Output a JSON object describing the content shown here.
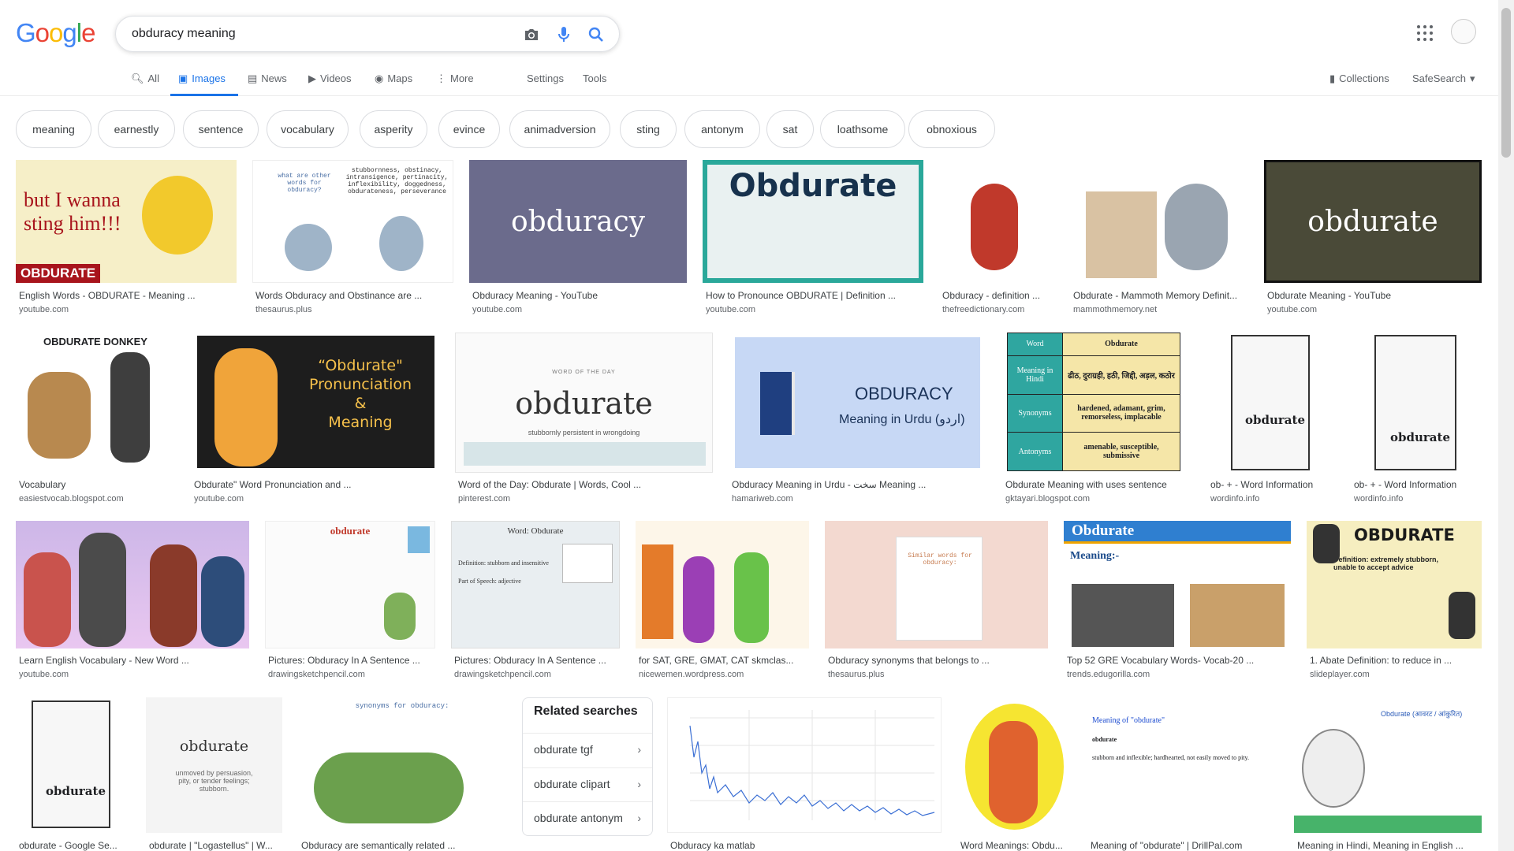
{
  "logo": {
    "letters": [
      "G",
      "o",
      "o",
      "g",
      "l",
      "e"
    ],
    "colors": [
      "#4285f4",
      "#ea4335",
      "#fbbc05",
      "#4285f4",
      "#34a853",
      "#ea4335"
    ]
  },
  "search": {
    "value": "obduracy meaning"
  },
  "tabs": {
    "all": "All",
    "images": "Images",
    "news": "News",
    "videos": "Videos",
    "maps": "Maps",
    "more": "More",
    "settings": "Settings",
    "tools": "Tools"
  },
  "right": {
    "collections": "Collections",
    "safesearch": "SafeSearch"
  },
  "chips": [
    "meaning",
    "earnestly",
    "sentence",
    "vocabulary",
    "asperity",
    "evince",
    "animadversion",
    "sting",
    "antonym",
    "sat",
    "loathsome",
    "obnoxious"
  ],
  "row1": [
    {
      "title": "English Words - OBDURATE - Meaning ...",
      "src": "youtube.com",
      "text1": "but I wanna",
      "text2": "sting him!!!",
      "text3": "OBDURATE"
    },
    {
      "title": "Words Obduracy and Obstinance are ...",
      "src": "thesaurus.plus",
      "text1": "what are other words for obduracy?",
      "text2": "stubbornness, obstinacy, intransigence, pertinacity, inflexibility, doggedness, obdurateness, perseverance"
    },
    {
      "title": "Obduracy Meaning - YouTube",
      "src": "youtube.com",
      "text1": "obduracy"
    },
    {
      "title": "How to Pronounce OBDURATE | Definition ...",
      "src": "youtube.com",
      "text1": "Obdurate"
    },
    {
      "title": "Obduracy - definition ...",
      "src": "thefreedictionary.com"
    },
    {
      "title": "Obdurate - Mammoth Memory Definit...",
      "src": "mammothmemory.net"
    },
    {
      "title": "Obdurate Meaning - YouTube",
      "src": "youtube.com",
      "text1": "obdurate"
    }
  ],
  "row2": [
    {
      "title": "Vocabulary",
      "src": "easiestvocab.blogspot.com",
      "text1": "OBDURATE DONKEY"
    },
    {
      "title": "Obdurate\" Word Pronunciation and ...",
      "src": "youtube.com",
      "text1": "“Obdurate\"",
      "text2": "Pronunciation",
      "text3": "&",
      "text4": "Meaning"
    },
    {
      "title": "Word of the Day: Obdurate | Words, Cool ...",
      "src": "pinterest.com",
      "text1": "WORD OF THE DAY",
      "text2": "obdurate",
      "text3": "stubbornly persistent in wrongdoing"
    },
    {
      "title": "Obduracy Meaning in Urdu - سخت Meaning ...",
      "src": "hamariweb.com",
      "text1": "OBDURACY",
      "text2": "Meaning in Urdu (اردو)"
    },
    {
      "title": "Obdurate Meaning with uses sentence",
      "src": "gktayari.blogspot.com",
      "rows": [
        [
          "Word",
          "Obdurate"
        ],
        [
          "Meaning in Hindi",
          "ढीठ, दुराग्रही, हठी, जिद्दी, अड़ल, कठोर"
        ],
        [
          "Synonyms",
          "hardened, adamant, grim, remorseless, implacable"
        ],
        [
          "Antonyms",
          "amenable, susceptible, submissive"
        ]
      ]
    },
    {
      "title": "ob- + - Word Information",
      "src": "wordinfo.info",
      "text1": "obdurate"
    },
    {
      "title": "ob- + - Word Information",
      "src": "wordinfo.info",
      "text1": "obdurate"
    }
  ],
  "row3": [
    {
      "title": "Learn English Vocabulary - New Word ...",
      "src": "youtube.com"
    },
    {
      "title": "Pictures: Obduracy In A Sentence ...",
      "src": "drawingsketchpencil.com",
      "text1": "obdurate"
    },
    {
      "title": "Pictures: Obduracy In A Sentence ...",
      "src": "drawingsketchpencil.com",
      "text1": "Word: Obdurate",
      "text2": "Definition: stubborn and insensitive",
      "text3": "Part of Speech: adjective"
    },
    {
      "title": "for SAT, GRE, GMAT, CAT skmclas...",
      "src": "nicewemen.wordpress.com"
    },
    {
      "title": "Obduracy synonyms that belongs to ...",
      "src": "thesaurus.plus",
      "text1": "Similar words for obduracy:"
    },
    {
      "title": "Top 52 GRE Vocabulary Words- Vocab-20 ...",
      "src": "trends.edugorilla.com",
      "text1": "Obdurate",
      "text2": "Meaning:-"
    },
    {
      "title": "1. Abate Definition: to reduce in ...",
      "src": "slideplayer.com",
      "text1": "OBDURATE",
      "text2": "Definition: extremely stubborn, unable to accept advice"
    }
  ],
  "row4": [
    {
      "title": "obdurate - Google Se...",
      "text1": "obdurate"
    },
    {
      "title": "obdurate | \"Logastellus\" | W...",
      "text1": "obdurate",
      "text2": "unmoved by persuasion, pity, or tender feelings; stubborn."
    },
    {
      "title": "Obduracy are semantically related ...",
      "text1": "synonyms for obduracy:"
    },
    {
      "title": "Obduracy ka matlab"
    },
    {
      "title": "Word Meanings: Obdu..."
    },
    {
      "title": "Meaning of \"obdurate\" | DrillPal.com",
      "text1": "Meaning of \"obdurate\"",
      "text2": "obdurate",
      "text3": "stubborn and inflexible; hardhearted, not easily moved to pity."
    },
    {
      "title": "Meaning in Hindi, Meaning in English ...",
      "text1": "Obdurate (आवरट / आंकुरित)"
    }
  ],
  "related": {
    "heading": "Related searches",
    "items": [
      "obdurate tgf",
      "obdurate clipart",
      "obdurate antonym"
    ]
  }
}
